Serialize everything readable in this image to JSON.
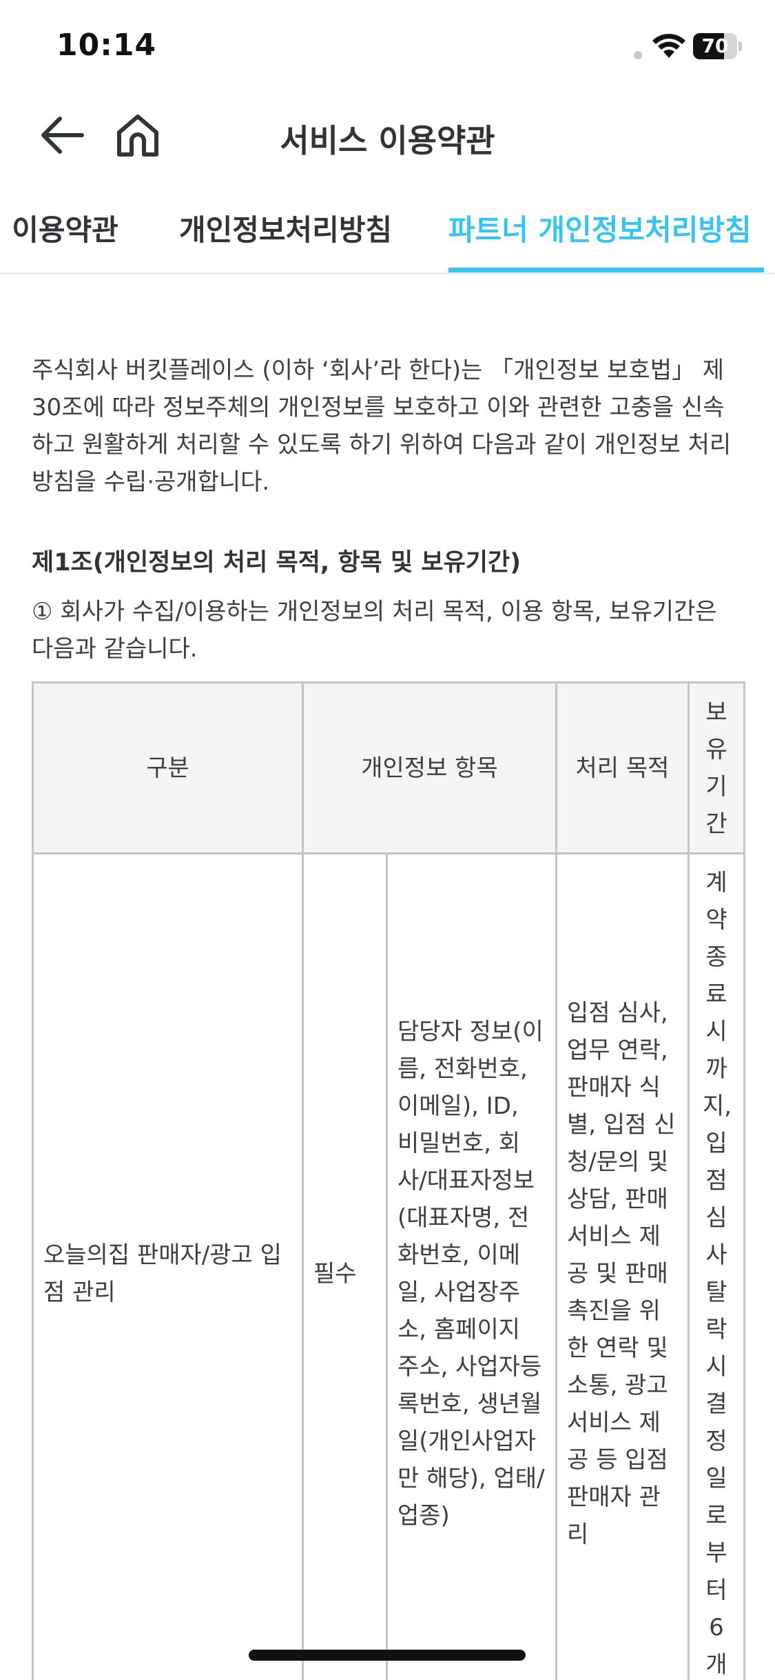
{
  "status": {
    "time": "10:14",
    "battery": "70",
    "battery_level": 0.7
  },
  "header": {
    "title": "서비스 이용약관",
    "back_icon": "arrow-left-icon",
    "home_icon": "home-icon"
  },
  "tabs": [
    {
      "label": "…책 이용약관",
      "active": false
    },
    {
      "label": "개인정보처리방침",
      "active": false
    },
    {
      "label": "파트너 개인정보처리방침",
      "active": true
    }
  ],
  "content": {
    "intro": "주식회사 버킷플레이스 (이하 ‘회사’라 한다)는 「개인정보 보호법」 제30조에 따라 정보주체의 개인정보를 보호하고 이와 관련한 고충을 신속하고 원활하게 처리할 수 있도록 하기 위하여 다음과 같이 개인정보 처리방침을 수립·공개합니다.",
    "article1_title": "제1조(개인정보의 처리 목적, 항목 및 보유기간)",
    "article1_para": "① 회사가 수집/이용하는 개인정보의 처리 목적, 이용 항목, 보유기간은 다음과 같습니다.",
    "table": {
      "headers": [
        "구분",
        "개인정보 항목",
        "처리 목적",
        "보유기간"
      ],
      "rows": [
        {
          "category": "오늘의집 판매자/광고 입점 관리",
          "required": "필수",
          "items": "담당자 정보(이름, 전화번호, 이메일), ID, 비밀번호, 회사/대표자정보(대표자명, 전화번호, 이메일, 사업장주소, 홈페이지 주소, 사업자등록번호, 생년월일(개인사업자만 해당), 업태/업종)",
          "purpose": "입점 심사, 업무 연락, 판매자 식별, 입점 신청/문의 및 상담, 판매서비스 제공 및 판매촉진을 위한 연락 및 소통, 광고서비스 제공 등 입점판매자 관리",
          "period": "계약종료시까지,입점심사탈락시결정일로부터6개"
        }
      ]
    }
  },
  "colors": {
    "accent": "#35c5f0",
    "text": "#2f3438",
    "border": "#c4c4c4",
    "header_bg": "#f4f4f4"
  }
}
